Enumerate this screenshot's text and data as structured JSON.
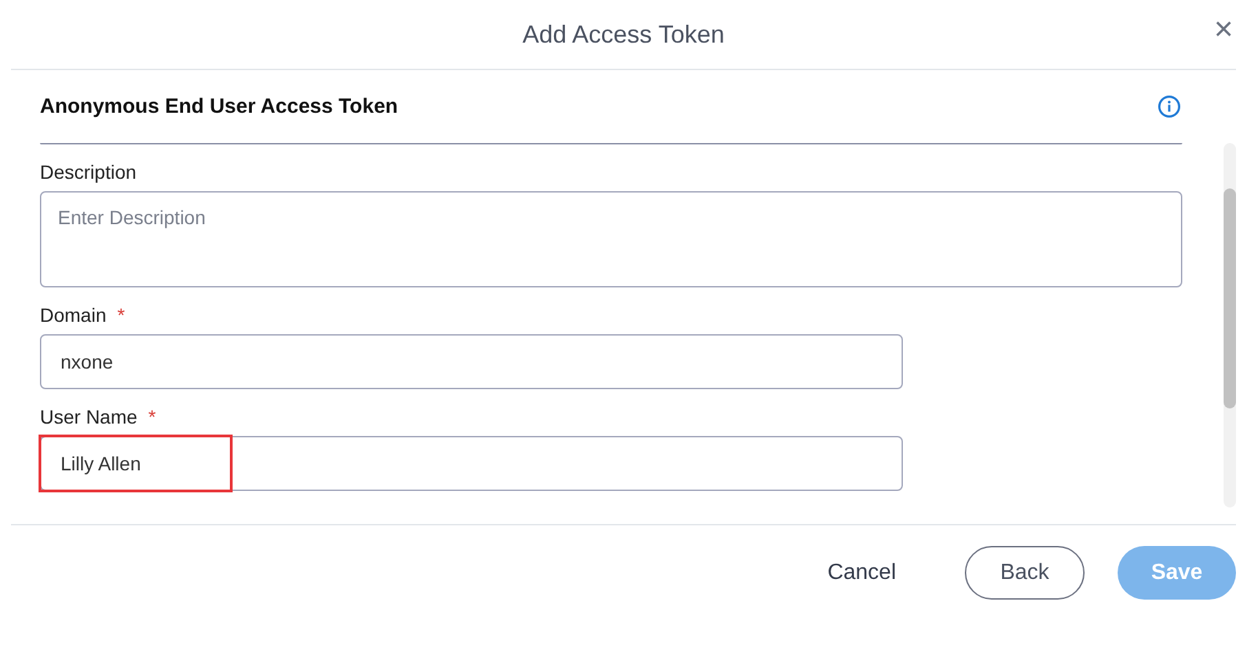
{
  "dialog": {
    "title": "Add Access Token",
    "close": "×"
  },
  "section": {
    "title": "Anonymous End User Access Token"
  },
  "fields": [
    {
      "kind": "textarea",
      "label": "Description",
      "placeholder": "Enter Description",
      "highlighted": false
    },
    {
      "kind": "input",
      "label": "Domain",
      "required_mark": "*",
      "value": "nxone",
      "highlighted": false
    },
    {
      "kind": "input",
      "label": "User Name",
      "required_mark": "*",
      "value": "Lilly Allen",
      "highlighted": true
    }
  ],
  "buttons": [
    {
      "kind": "text",
      "label": "Cancel",
      "disabled": false
    },
    {
      "kind": "outline",
      "label": "Back",
      "disabled": false
    },
    {
      "kind": "primary",
      "label": "Save",
      "disabled": true
    }
  ]
}
